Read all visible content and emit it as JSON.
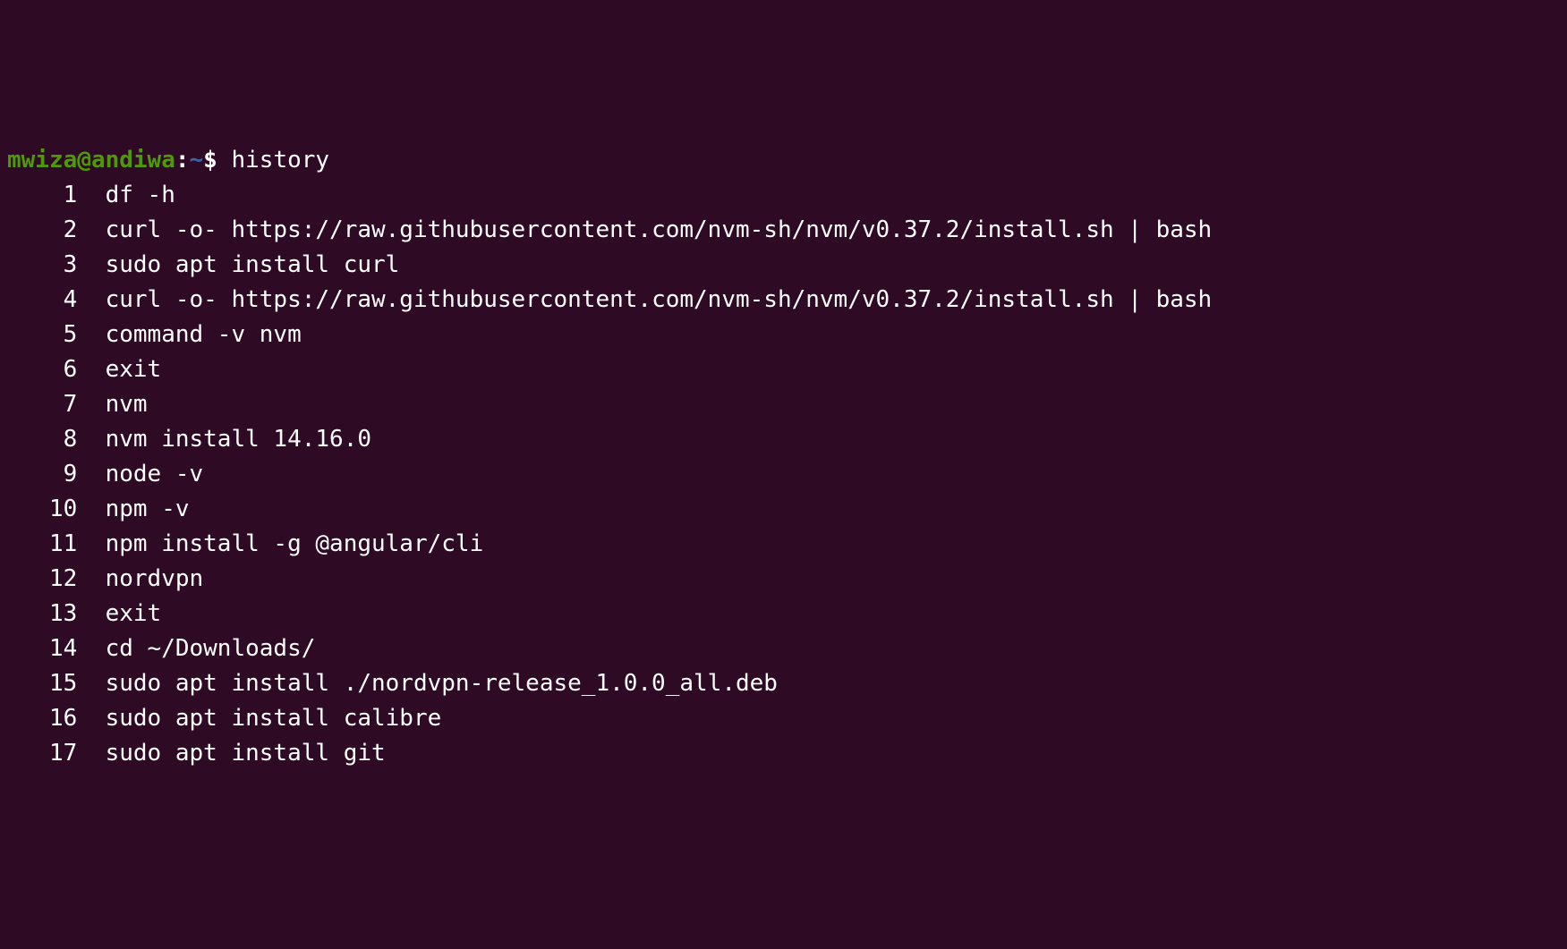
{
  "prompt": {
    "user": "mwiza",
    "at": "@",
    "host": "andiwa",
    "colon": ":",
    "path": "~",
    "dollar": "$"
  },
  "command": "history",
  "history": [
    {
      "num": "1",
      "cmd": "df -h"
    },
    {
      "num": "2",
      "cmd": "curl -o- https://raw.githubusercontent.com/nvm-sh/nvm/v0.37.2/install.sh | bash"
    },
    {
      "num": "3",
      "cmd": "sudo apt install curl"
    },
    {
      "num": "4",
      "cmd": "curl -o- https://raw.githubusercontent.com/nvm-sh/nvm/v0.37.2/install.sh | bash"
    },
    {
      "num": "5",
      "cmd": "command -v nvm"
    },
    {
      "num": "6",
      "cmd": "exit"
    },
    {
      "num": "7",
      "cmd": "nvm"
    },
    {
      "num": "8",
      "cmd": "nvm install 14.16.0"
    },
    {
      "num": "9",
      "cmd": "node -v"
    },
    {
      "num": "10",
      "cmd": "npm -v"
    },
    {
      "num": "11",
      "cmd": "npm install -g @angular/cli"
    },
    {
      "num": "12",
      "cmd": "nordvpn"
    },
    {
      "num": "13",
      "cmd": "exit"
    },
    {
      "num": "14",
      "cmd": "cd ~/Downloads/"
    },
    {
      "num": "15",
      "cmd": "sudo apt install ./nordvpn-release_1.0.0_all.deb"
    },
    {
      "num": "16",
      "cmd": "sudo apt install calibre"
    },
    {
      "num": "17",
      "cmd": "sudo apt install git"
    }
  ]
}
